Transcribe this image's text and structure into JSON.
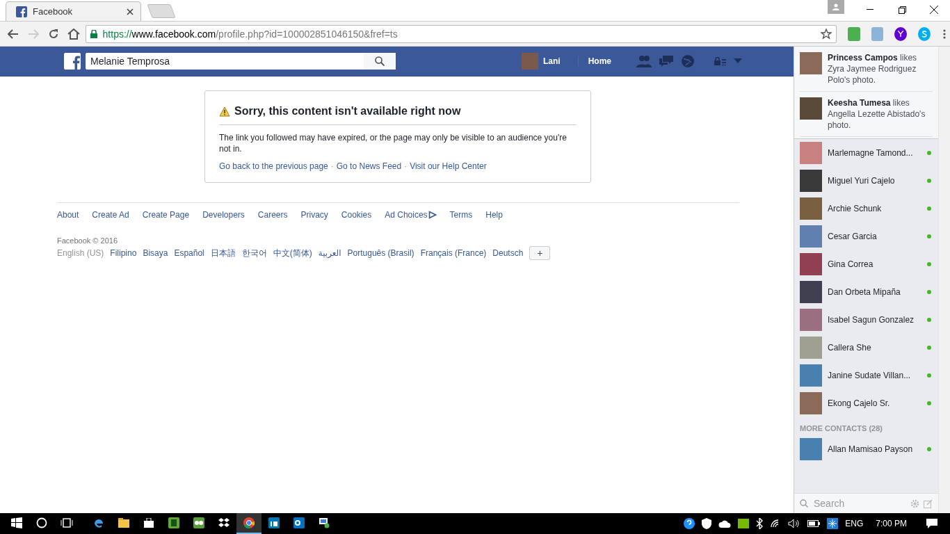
{
  "browser": {
    "tab": {
      "title": "Facebook",
      "selected": true
    },
    "url": {
      "scheme": "https://",
      "host": "www.facebook.com",
      "path": "/profile.php?id=100002851046150&fref=ts"
    }
  },
  "header": {
    "search": {
      "value": "Melanie Temprosa"
    },
    "user": "Lani",
    "home": "Home"
  },
  "notice": {
    "title": "Sorry, this content isn't available right now",
    "body": "The link you followed may have expired, or the page may only be visible to an audience you're not in.",
    "links": [
      "Go back to the previous page",
      "Go to News Feed",
      "Visit our Help Center"
    ],
    "separator": "·"
  },
  "footer": {
    "links": [
      "About",
      "Create Ad",
      "Create Page",
      "Developers",
      "Careers",
      "Privacy",
      "Cookies",
      "Ad Choices",
      "Terms",
      "Help"
    ],
    "copyright": "Facebook © 2016",
    "languages": [
      {
        "label": "English (US)",
        "selected": true
      },
      {
        "label": "Filipino",
        "selected": false
      },
      {
        "label": "Bisaya",
        "selected": false
      },
      {
        "label": "Español",
        "selected": false
      },
      {
        "label": "日本語",
        "selected": false
      },
      {
        "label": "한국어",
        "selected": false
      },
      {
        "label": "中文(简体)",
        "selected": false
      },
      {
        "label": "العربية",
        "selected": false
      },
      {
        "label": "Português (Brasil)",
        "selected": false
      },
      {
        "label": "Français (France)",
        "selected": false
      },
      {
        "label": "Deutsch",
        "selected": false
      }
    ],
    "more": "+"
  },
  "ticker": [
    {
      "text": "**Princess Campos** likes Zyra Jaymee Rodriguez Polo's photo."
    },
    {
      "text": "**Keesha Tumesa** likes Angella Lezette Abistado's photo."
    }
  ],
  "contacts": [
    {
      "name": "Marlemagne Tamond...",
      "online": true
    },
    {
      "name": "Miguel Yuri Cajelo",
      "online": true
    },
    {
      "name": "Archie Schunk",
      "online": true
    },
    {
      "name": "Cesar Garcia",
      "online": true
    },
    {
      "name": "Gina Correa",
      "online": true
    },
    {
      "name": "Dan Orbeta Mipaña",
      "online": true
    },
    {
      "name": "Isabel Sagun Gonzalez",
      "online": true
    },
    {
      "name": "Callera She",
      "online": true
    },
    {
      "name": "Janine Sudate Villan...",
      "online": true
    },
    {
      "name": "Ekong Cajelo Sr.",
      "online": true
    }
  ],
  "more_contacts": {
    "heading": "MORE CONTACTS (28)",
    "items": [
      {
        "name": "Allan Mamisao Payson",
        "online": true
      }
    ]
  },
  "chat_search": {
    "placeholder": "Search"
  },
  "taskbar": {
    "apps": [
      {
        "kind": "edge",
        "selected": false
      },
      {
        "kind": "folder",
        "selected": false
      },
      {
        "kind": "store",
        "selected": false
      },
      {
        "kind": "note",
        "selected": false
      },
      {
        "kind": "owl",
        "selected": false
      },
      {
        "kind": "dropbox",
        "selected": false
      },
      {
        "kind": "chrome",
        "selected": true
      },
      {
        "kind": "linkedin",
        "selected": false
      },
      {
        "kind": "outlook",
        "selected": false
      },
      {
        "kind": "remote",
        "selected": false
      }
    ],
    "language": "ENG",
    "time": "7:00 PM"
  }
}
